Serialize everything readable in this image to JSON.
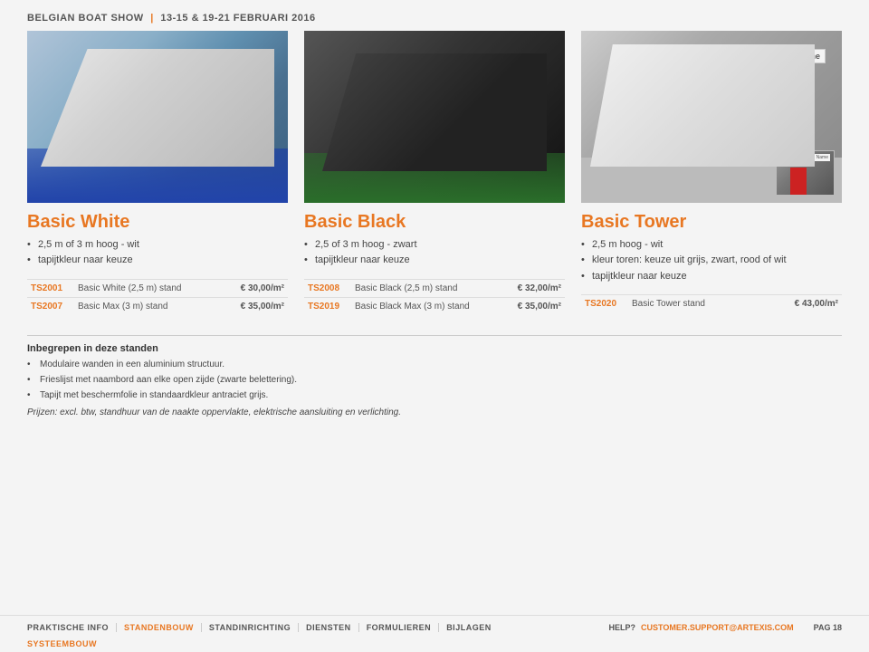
{
  "header": {
    "event": "BELGIAN BOAT SHOW",
    "separator": "|",
    "dates": "13-15 & 19-21 FEBRUARI 2016"
  },
  "products": [
    {
      "id": "basic-white",
      "name": "Basic White",
      "bullets": [
        "2,5 m of 3 m hoog - wit",
        "tapijtkleur naar keuze"
      ],
      "pricing": [
        {
          "code": "TS2001",
          "desc": "Basic White (2,5 m) stand",
          "price": "€ 30,00/m²"
        },
        {
          "code": "TS2007",
          "desc": "Basic Max (3 m) stand",
          "price": "€ 35,00/m²"
        }
      ]
    },
    {
      "id": "basic-black",
      "name": "Basic Black",
      "bullets": [
        "2,5 of 3 m hoog - zwart",
        "tapijtkleur naar keuze"
      ],
      "pricing": [
        {
          "code": "TS2008",
          "desc": "Basic Black (2,5 m) stand",
          "price": "€ 32,00/m²"
        },
        {
          "code": "TS2019",
          "desc": "Basic Black Max (3 m) stand",
          "price": "€ 35,00/m²"
        }
      ]
    },
    {
      "id": "basic-tower",
      "name": "Basic Tower",
      "bullets": [
        "2,5 m hoog - wit",
        "kleur toren: keuze uit grijs, zwart, rood of wit",
        "tapijtkleur naar keuze"
      ],
      "pricing": [
        {
          "code": "TS2020",
          "desc": "Basic Tower stand",
          "price": "€ 43,00/m²"
        }
      ],
      "has_name_tag": true,
      "name_tag_text": "Name",
      "has_inset": true,
      "inset_name_text": "Name"
    }
  ],
  "included_section": {
    "title": "Inbegrepen in deze standen",
    "bullets": [
      "Modulaire wanden in een aluminium structuur.",
      "Frieslijst met naambord aan elke open zijde (zwarte belettering).",
      "Tapijt met beschermfolie in standaardkleur antraciet grijs."
    ],
    "note": "Prijzen: excl. btw, standhuur van de naakte oppervlakte, elektrische aansluiting en verlichting."
  },
  "footer": {
    "nav_items": [
      {
        "label": "PRAKTISCHE INFO",
        "highlight": false
      },
      {
        "label": "STANDENBOUW",
        "highlight": true
      },
      {
        "label": "STANDINRICHTING",
        "highlight": false
      },
      {
        "label": "DIENSTEN",
        "highlight": false
      },
      {
        "label": "FORMULIEREN",
        "highlight": false
      },
      {
        "label": "BIJLAGEN",
        "highlight": false
      }
    ],
    "help_label": "HELP?",
    "email": "CUSTOMER.SUPPORT@ARTEXIS.COM",
    "page_label": "PAG 18",
    "sub_nav_items": [
      {
        "label": "SYSTEEMBOUW"
      }
    ]
  }
}
